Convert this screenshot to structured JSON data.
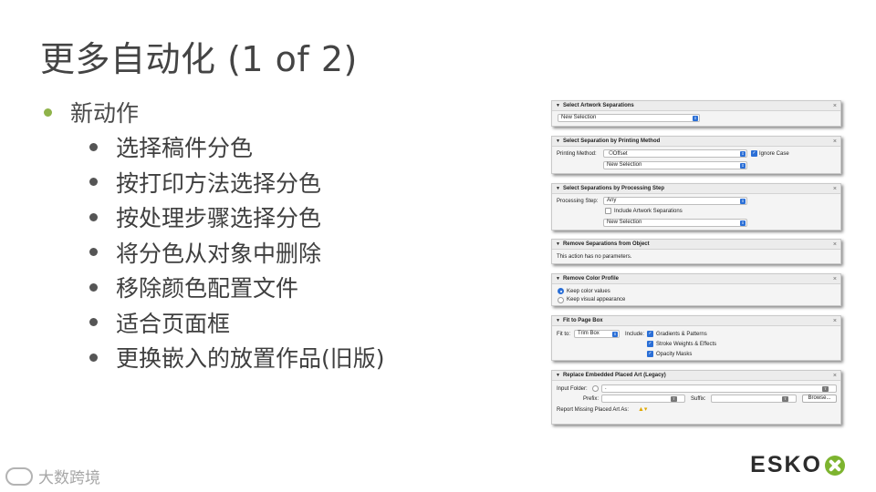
{
  "slide": {
    "title": "更多自动化 (1 of 2)",
    "bullet_main": "新动作",
    "bullets": [
      "选择稿件分色",
      "按打印方法选择分色",
      "按处理步骤选择分色",
      "将分色从对象中删除",
      "移除颜色配置文件",
      "适合页面框",
      "更换嵌入的放置作品(旧版)"
    ],
    "colors": {
      "accent_bullet": "#8fb34a",
      "brand_green": "#7db42f"
    }
  },
  "panels": {
    "select_artwork": {
      "title": "Select Artwork Separations",
      "selection": "New Selection"
    },
    "by_printing_method": {
      "title": "Select Separation by Printing Method",
      "label": "Printing Method:",
      "method": "Offset",
      "ignore_case": "Ignore Case",
      "selection": "New Selection"
    },
    "by_processing_step": {
      "title": "Select Separations by Processing Step",
      "label": "Processing Step:",
      "step": "Any",
      "include": "Include Artwork Separations",
      "selection": "New Selection"
    },
    "remove_separations": {
      "title": "Remove Separations from Object",
      "message": "This action has no parameters."
    },
    "remove_color_profile": {
      "title": "Remove Color Profile",
      "opt1": "Keep color values",
      "opt2": "Keep visual appearance"
    },
    "fit_to_page": {
      "title": "Fit to Page Box",
      "fit_label": "Fit to:",
      "fit_value": "Trim Box",
      "include_label": "Include:",
      "inc1": "Gradients & Patterns",
      "inc2": "Stroke Weights & Effects",
      "inc3": "Opacity Masks"
    },
    "replace_embedded": {
      "title": "Replace Embedded Placed Art (Legacy)",
      "input_folder_label": "Input Folder:",
      "input_folder_value": ".",
      "prefix_label": "Prefix:",
      "suffix_label": "Suffix:",
      "browse": "Browse...",
      "report_label": "Report Missing Placed Art As:"
    },
    "close_glyph": "×",
    "collapse_glyph": "▼"
  },
  "brand": {
    "name": "ESKO"
  },
  "watermark": {
    "text": "大数跨境"
  }
}
